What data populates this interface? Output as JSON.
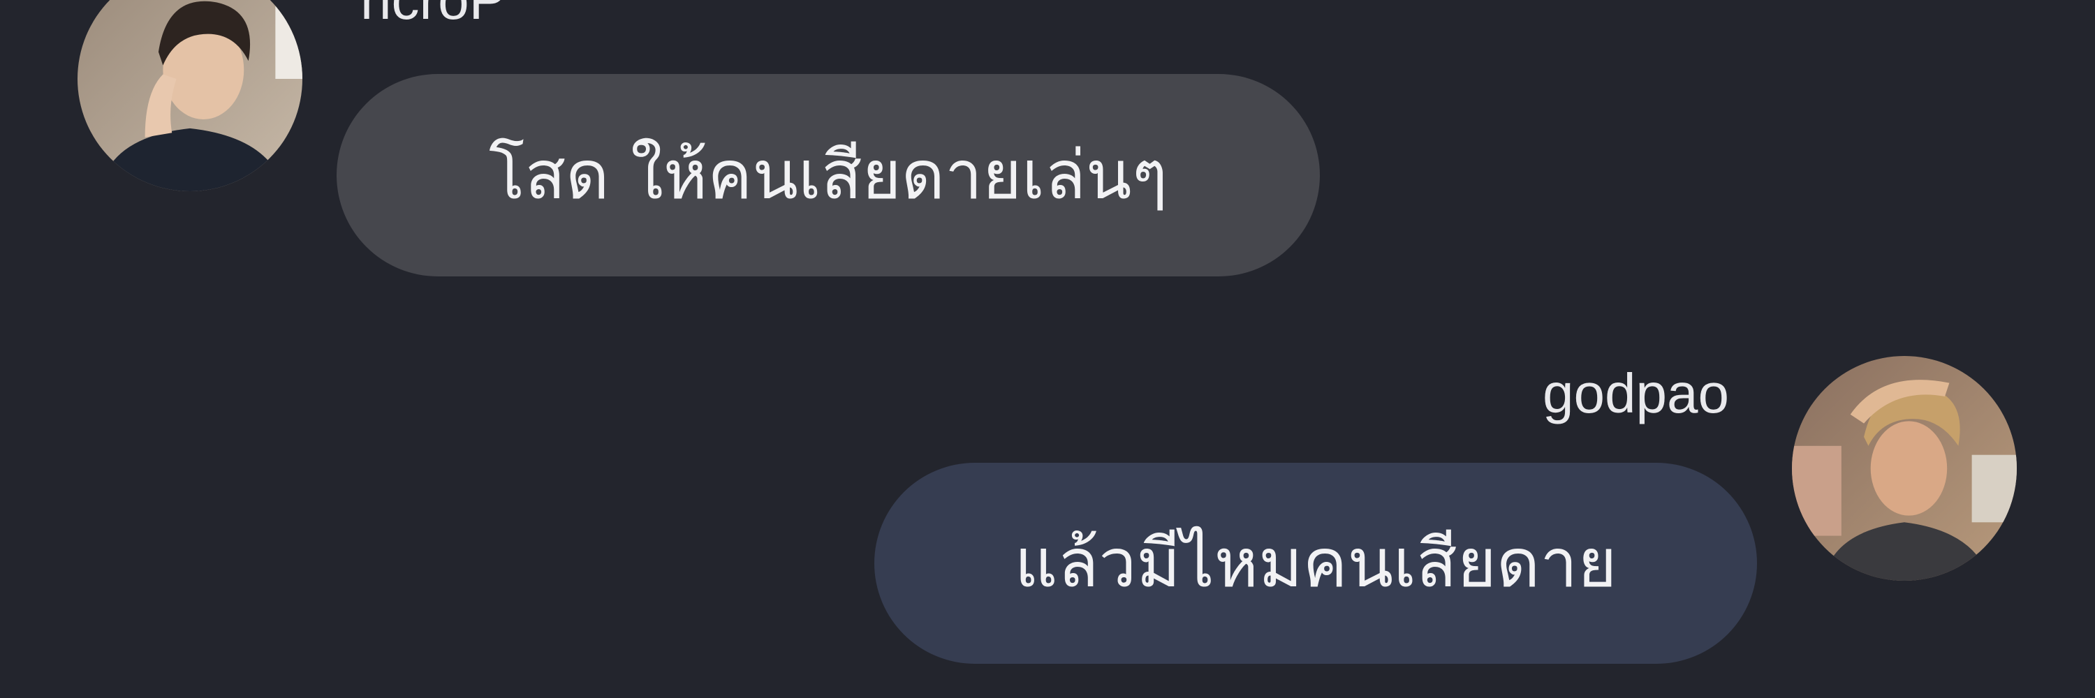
{
  "conversation": {
    "messages": [
      {
        "sender": "ncroP",
        "text": "โสด ให้คนเสียดายเล่นๆ",
        "avatar_icon": "user-avatar-photo",
        "side": "left"
      },
      {
        "sender": "godpao",
        "text": "แล้วมีไหมคนเสียดาย",
        "avatar_icon": "user-avatar-photo",
        "side": "right"
      }
    ]
  },
  "colors": {
    "background": "#23252d",
    "incoming_bubble": "#46474d",
    "outgoing_bubble": "#363d51",
    "text": "#f2f2f4"
  }
}
